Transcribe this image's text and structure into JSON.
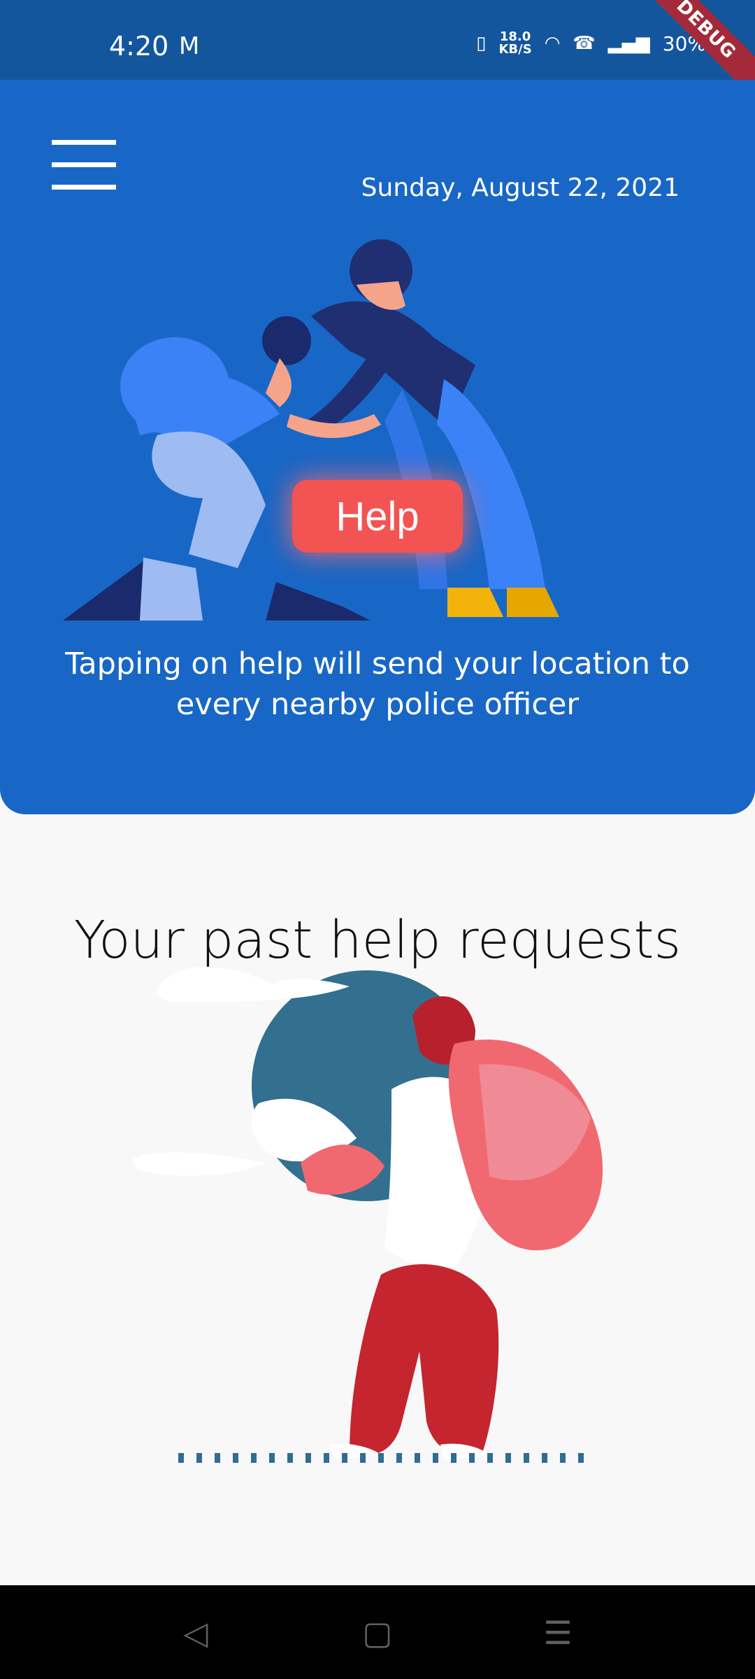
{
  "status_bar": {
    "time": "4:20",
    "mail_icon": "gmail-icon",
    "network_speed_value": "18.0",
    "network_speed_unit": "KB/S",
    "battery_text": "30%",
    "debug_label": "DEBUG"
  },
  "hero": {
    "date": "Sunday, August 22, 2021",
    "help_label": "Help",
    "caption": "Tapping on help will send your location to every nearby police officer",
    "background": "#1867c6",
    "help_button_color": "#f25454"
  },
  "past_requests": {
    "title": "Your past help requests"
  },
  "navigation": {
    "back_icon": "back-triangle-icon",
    "home_icon": "home-square-icon",
    "menu_icon": "recent-menu-icon"
  }
}
